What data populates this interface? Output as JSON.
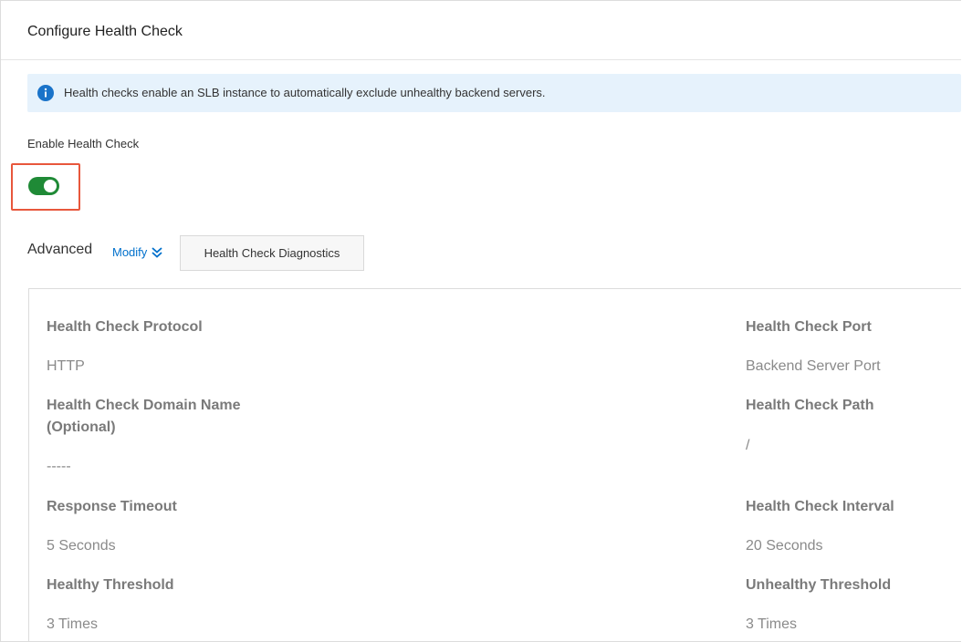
{
  "header": {
    "title": "Configure Health Check"
  },
  "info_banner": {
    "icon": "info-icon",
    "text": "Health checks enable an SLB instance to automatically exclude unhealthy backend servers.",
    "color": "#1a73c9"
  },
  "enable_health_check": {
    "label": "Enable Health Check",
    "enabled": true,
    "toggle_color": "#1f8a36",
    "highlight_color": "#e8573c"
  },
  "advanced": {
    "label": "Advanced",
    "modify_label": "Modify",
    "diagnostics_label": "Health Check Diagnostics"
  },
  "fields": {
    "protocol": {
      "label": "Health Check Protocol",
      "value": "HTTP"
    },
    "port": {
      "label": "Health Check Port",
      "value": "Backend Server Port"
    },
    "domain_name": {
      "label_line1": "Health Check Domain Name",
      "label_line2": "(Optional)",
      "value": "-----"
    },
    "path": {
      "label": "Health Check Path",
      "value": "/"
    },
    "response_timeout": {
      "label": "Response Timeout",
      "value": "5 Seconds"
    },
    "interval": {
      "label": "Health Check Interval",
      "value": "20 Seconds"
    },
    "healthy_threshold": {
      "label": "Healthy Threshold",
      "value": "3 Times"
    },
    "unhealthy_threshold": {
      "label": "Unhealthy Threshold",
      "value": "3 Times"
    }
  }
}
